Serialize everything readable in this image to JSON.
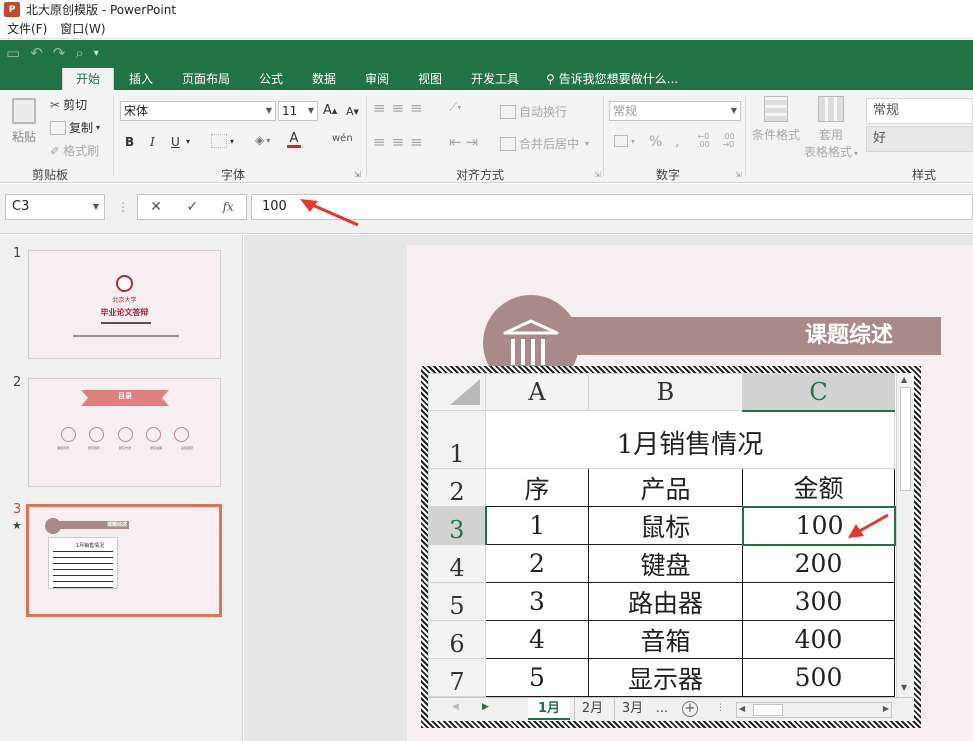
{
  "app": {
    "logo": "P",
    "title": "北大原创模版 - PowerPoint"
  },
  "menu": [
    "文件(F)",
    "窗口(W)"
  ],
  "tabs": [
    "开始",
    "插入",
    "页面布局",
    "公式",
    "数据",
    "审阅",
    "视图",
    "开发工具"
  ],
  "tell_me": "告诉我您想要做什么...",
  "ribbon": {
    "paste": "粘贴",
    "cut": "剪切",
    "copy": "复制",
    "format_painter": "格式刷",
    "clipboard_label": "剪贴板",
    "font_name": "宋体",
    "font_size": "11",
    "bold": "B",
    "italic": "I",
    "underline": "U",
    "font_label": "字体",
    "wrap_text": "自动换行",
    "merge_center": "合并后居中",
    "alignment_label": "对齐方式",
    "number_format": "常规",
    "number_label": "数字",
    "conditional_format": "条件格式",
    "table_format_1": "套用",
    "table_format_2": "表格格式",
    "style_normal": "常规",
    "style_good": "好",
    "styles_label": "样式"
  },
  "formula": {
    "cell_ref": "C3",
    "cancel": "✕",
    "enter": "✓",
    "fx": "fx",
    "value": "100"
  },
  "slides": [
    {
      "num": "1",
      "title": "毕业论文答辩",
      "logo_text": "北京大学"
    },
    {
      "num": "2",
      "title": "目录",
      "item_labels": [
        "课题背景",
        "研究现状",
        "研究方法",
        "研究进展",
        "总结展望"
      ]
    },
    {
      "num": "3",
      "title": "课题综述",
      "star": "★",
      "mini_title": "1月销售情况"
    }
  ],
  "main_slide": {
    "title": "课题综述"
  },
  "sheet": {
    "columns": [
      "A",
      "B",
      "C"
    ],
    "row_numbers": [
      "1",
      "2",
      "3",
      "4",
      "5",
      "6",
      "7"
    ],
    "title": "1月销售情况",
    "headers": [
      "序",
      "产品",
      "金额"
    ],
    "rows": [
      [
        "1",
        "鼠标",
        "100"
      ],
      [
        "2",
        "键盘",
        "200"
      ],
      [
        "3",
        "路由器",
        "300"
      ],
      [
        "4",
        "音箱",
        "400"
      ],
      [
        "5",
        "显示器",
        "500"
      ]
    ],
    "sheet_tabs": [
      "1月",
      "2月",
      "3月",
      "..."
    ]
  },
  "colors": {
    "ribbon_green": "#217346",
    "accent_rose": "#a98a89",
    "slide_bg": "#f6eef0",
    "annotation_red": "#e8352f",
    "selected_slide_border": "#e07353"
  }
}
